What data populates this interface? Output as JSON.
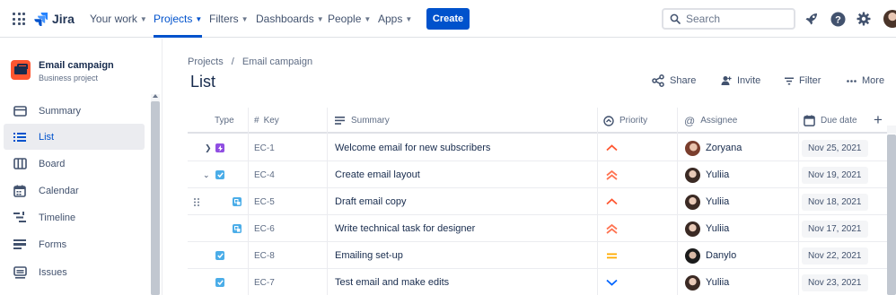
{
  "topnav": {
    "logo_text": "Jira",
    "items": [
      {
        "label": "Your work",
        "active": false
      },
      {
        "label": "Projects",
        "active": true
      },
      {
        "label": "Filters",
        "active": false
      },
      {
        "label": "Dashboards",
        "active": false
      },
      {
        "label": "People",
        "active": false
      },
      {
        "label": "Apps",
        "active": false
      }
    ],
    "create_label": "Create",
    "search_placeholder": "Search",
    "icons": [
      "app-switcher-icon",
      "jira-logo-icon",
      "rocket-icon",
      "help-icon",
      "settings-icon",
      "user-avatar"
    ]
  },
  "sidebar": {
    "project_name": "Email campaign",
    "project_type": "Business project",
    "items": [
      {
        "label": "Summary",
        "icon": "summary-icon",
        "active": false
      },
      {
        "label": "List",
        "icon": "list-icon",
        "active": true
      },
      {
        "label": "Board",
        "icon": "board-icon",
        "active": false
      },
      {
        "label": "Calendar",
        "icon": "calendar-icon",
        "active": false
      },
      {
        "label": "Timeline",
        "icon": "timeline-icon",
        "active": false
      },
      {
        "label": "Forms",
        "icon": "forms-icon",
        "active": false
      },
      {
        "label": "Issues",
        "icon": "issues-icon",
        "active": false
      }
    ]
  },
  "main": {
    "breadcrumb": [
      "Projects",
      "Email campaign"
    ],
    "breadcrumb_sep": "/",
    "title": "List",
    "actions": [
      {
        "label": "Share",
        "icon": "share-icon"
      },
      {
        "label": "Invite",
        "icon": "invite-icon"
      },
      {
        "label": "Filter",
        "icon": "filter-icon"
      },
      {
        "label": "More",
        "icon": "more-icon"
      }
    ]
  },
  "table": {
    "columns": [
      {
        "label": "Type",
        "icon": ""
      },
      {
        "label": "Key",
        "icon": "hash-icon"
      },
      {
        "label": "Summary",
        "icon": "lines-icon"
      },
      {
        "label": "Priority",
        "icon": "priority-circle-icon"
      },
      {
        "label": "Assignee",
        "icon": "at-icon"
      },
      {
        "label": "Due date",
        "icon": "calendar-icon"
      }
    ],
    "rows": [
      {
        "key": "EC-1",
        "type": "epic",
        "expander": "collapsed",
        "summary": "Welcome email for new subscribers",
        "priority": "medium",
        "assignee": "Zoryana",
        "due": "Nov 25, 2021"
      },
      {
        "key": "EC-4",
        "type": "task",
        "expander": "expanded",
        "summary": "Create email layout",
        "priority": "high",
        "assignee": "Yuliia",
        "due": "Nov 19, 2021"
      },
      {
        "key": "EC-5",
        "type": "subtask",
        "expander": "none",
        "summary": "Draft email copy",
        "priority": "medium",
        "assignee": "Yuliia",
        "due": "Nov 18, 2021"
      },
      {
        "key": "EC-6",
        "type": "subtask",
        "expander": "none",
        "summary": "Write technical task for designer",
        "priority": "high",
        "assignee": "Yuliia",
        "due": "Nov 17, 2021"
      },
      {
        "key": "EC-8",
        "type": "task",
        "expander": "none",
        "summary": "Emailing set-up",
        "priority": "equal",
        "assignee": "Danylo",
        "due": "Nov 22, 2021"
      },
      {
        "key": "EC-7",
        "type": "task",
        "expander": "none",
        "summary": "Test email and make edits",
        "priority": "low",
        "assignee": "Yuliia",
        "due": "Nov 23, 2021"
      }
    ]
  },
  "colors": {
    "brand": "#0052cc",
    "epic": "#904ee2",
    "task": "#4bade8",
    "priority_medium": "#ff5630",
    "priority_high": "#ff7452",
    "priority_equal": "#ffab00",
    "priority_low": "#0065ff"
  }
}
